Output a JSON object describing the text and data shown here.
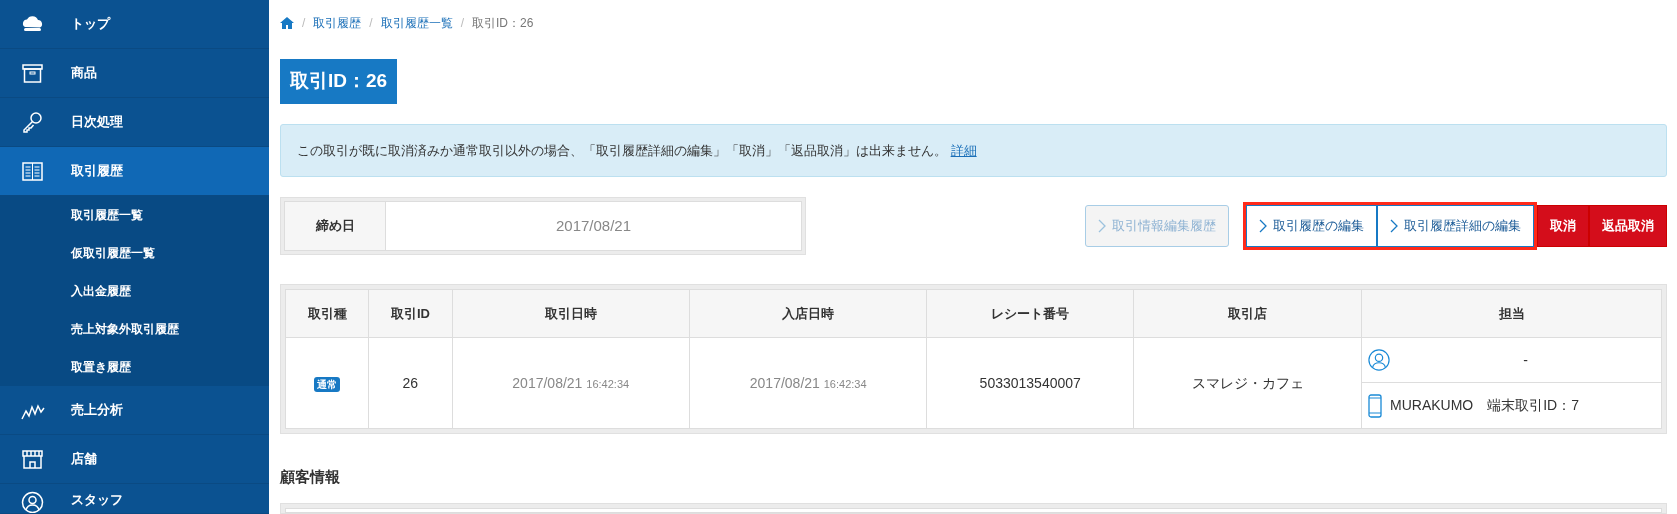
{
  "sidebar": {
    "items": [
      {
        "label": "トップ",
        "kind": "cloud",
        "selected": false
      },
      {
        "label": "商品",
        "kind": "box",
        "selected": false
      },
      {
        "label": "日次処理",
        "kind": "key",
        "selected": false
      },
      {
        "label": "取引履歴",
        "kind": "book",
        "selected": true,
        "expanded": true,
        "children": [
          {
            "label": "取引履歴一覧"
          },
          {
            "label": "仮取引履歴一覧"
          },
          {
            "label": "入出金履歴"
          },
          {
            "label": "売上対象外取引履歴"
          },
          {
            "label": "取置き履歴"
          }
        ]
      },
      {
        "label": "売上分析",
        "kind": "chart",
        "selected": false
      },
      {
        "label": "店舗",
        "kind": "shop",
        "selected": false
      },
      {
        "label": "スタッフ",
        "kind": "person",
        "selected": false
      }
    ]
  },
  "breadcrumb": {
    "separator": "/",
    "items": [
      {
        "kind": "home"
      },
      {
        "kind": "link",
        "label": "取引履歴"
      },
      {
        "kind": "link",
        "label": "取引履歴一覧"
      },
      {
        "kind": "current",
        "label": "取引ID：26"
      }
    ]
  },
  "page_title": "取引ID：26",
  "alert": {
    "text": "この取引が既に取消済みか通常取引以外の場合、「取引履歴詳細の編集」「取消」「返品取消」は出来ません。",
    "link": "詳細"
  },
  "closing_date": {
    "label": "締め日",
    "value": "2017/08/21"
  },
  "actions": [
    {
      "label": "取引情報編集履歴",
      "kind": "outline",
      "disabled": true,
      "highlighted": false
    },
    {
      "label": "取引履歴の編集",
      "kind": "outline",
      "disabled": false,
      "highlighted": true
    },
    {
      "label": "取引履歴詳細の編集",
      "kind": "outline",
      "disabled": false,
      "highlighted": true
    },
    {
      "label": "取消",
      "kind": "danger",
      "disabled": false,
      "highlighted": false
    },
    {
      "label": "返品取消",
      "kind": "danger",
      "disabled": false,
      "highlighted": false
    }
  ],
  "table": {
    "columns": [
      "取引種",
      "取引ID",
      "取引日時",
      "入店日時",
      "レシート番号",
      "取引店",
      "担当"
    ],
    "rows": [
      {
        "type_badge": "通常",
        "id": "26",
        "transaction_date": "2017/08/21",
        "transaction_time": "16:42:34",
        "entry_date": "2017/08/21",
        "entry_time": "16:42:34",
        "receipt_no": "5033013540007",
        "store": "スマレジ・カフェ",
        "staff": "-",
        "terminal": "MURAKUMO　端末取引ID：7"
      }
    ]
  },
  "customer_section": {
    "title": "顧客情報"
  }
}
